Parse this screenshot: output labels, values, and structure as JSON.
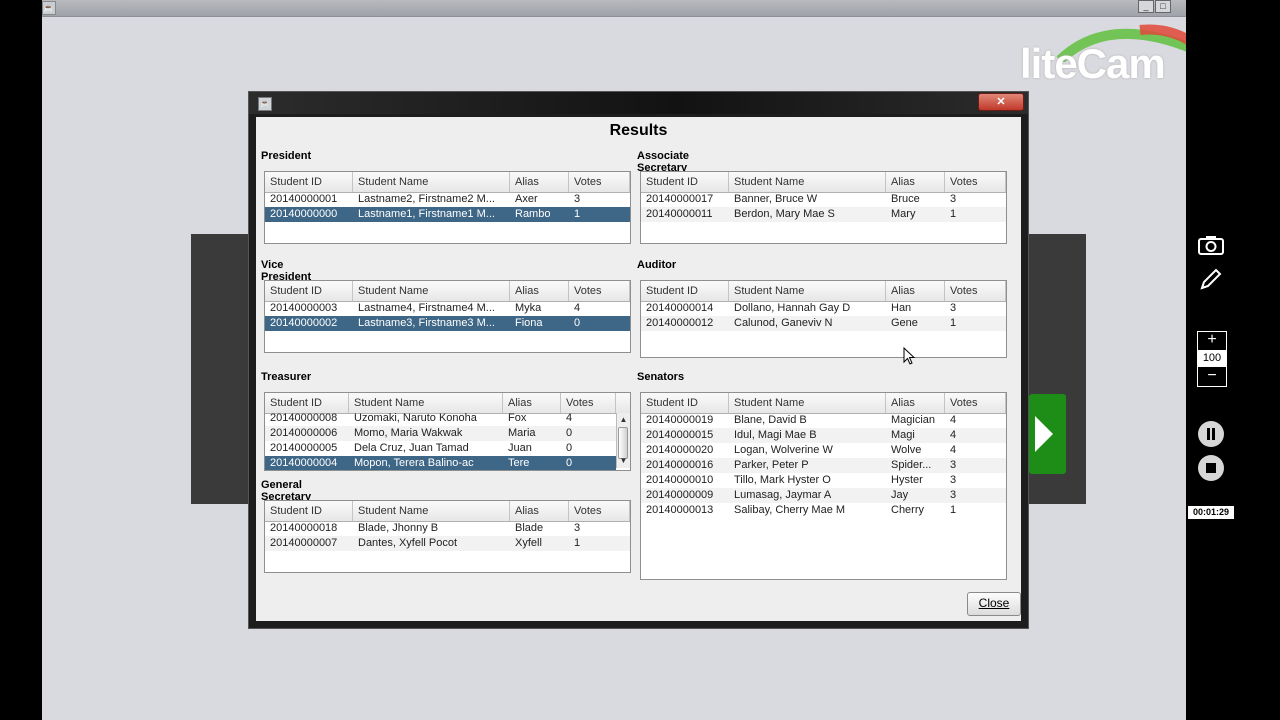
{
  "overlay": {
    "brand": "liteCam",
    "zoom_value": "100",
    "zoom_plus": "+",
    "zoom_minus": "−",
    "timer": "00:01:29"
  },
  "dialog": {
    "heading": "Results",
    "close_label": "Close",
    "columns": {
      "id": "Student ID",
      "name": "Student Name",
      "alias": "Alias",
      "votes": "Votes"
    },
    "sections": {
      "president": {
        "label": "President",
        "rows": [
          {
            "id": "20140000001",
            "name": "Lastname2, Firstname2  M...",
            "alias": "Axer",
            "votes": "3"
          },
          {
            "id": "20140000000",
            "name": "Lastname1, Firstname1  M...",
            "alias": "Rambo",
            "votes": "1"
          }
        ]
      },
      "vice_president": {
        "label": "Vice President",
        "rows": [
          {
            "id": "20140000003",
            "name": "Lastname4, Firstname4  M...",
            "alias": "Myka",
            "votes": "4"
          },
          {
            "id": "20140000002",
            "name": "Lastname3, Firstname3  M...",
            "alias": "Fiona",
            "votes": "0"
          }
        ]
      },
      "treasurer": {
        "label": "Treasurer",
        "rows": [
          {
            "id": "20140000008",
            "name": "Uzomaki, Naruto  Konoha",
            "alias": "Fox",
            "votes": "4"
          },
          {
            "id": "20140000006",
            "name": "Momo, Maria  Wakwak",
            "alias": "Maria",
            "votes": "0"
          },
          {
            "id": "20140000005",
            "name": "Dela Cruz, Juan  Tamad",
            "alias": "Juan",
            "votes": "0"
          },
          {
            "id": "20140000004",
            "name": "Mopon, Terera  Balino-ac",
            "alias": "Tere",
            "votes": "0"
          }
        ]
      },
      "general_secretary": {
        "label": "General Secretary",
        "rows": [
          {
            "id": "20140000018",
            "name": "Blade, Jhonny  B",
            "alias": "Blade",
            "votes": "3"
          },
          {
            "id": "20140000007",
            "name": "Dantes, Xyfell  Pocot",
            "alias": "Xyfell",
            "votes": "1"
          }
        ]
      },
      "associate_secretary": {
        "label": "Associate Secretary",
        "rows": [
          {
            "id": "20140000017",
            "name": "Banner, Bruce  W",
            "alias": "Bruce",
            "votes": "3"
          },
          {
            "id": "20140000011",
            "name": "Berdon, Mary Mae  S",
            "alias": "Mary",
            "votes": "1"
          }
        ]
      },
      "auditor": {
        "label": "Auditor",
        "rows": [
          {
            "id": "20140000014",
            "name": "Dollano, Hannah Gay  D",
            "alias": "Han",
            "votes": "3"
          },
          {
            "id": "20140000012",
            "name": "Calunod, Ganeviv  N",
            "alias": "Gene",
            "votes": "1"
          }
        ]
      },
      "senators": {
        "label": "Senators",
        "rows": [
          {
            "id": "20140000019",
            "name": "Blane, David  B",
            "alias": "Magician",
            "votes": "4"
          },
          {
            "id": "20140000015",
            "name": "Idul, Magi Mae  B",
            "alias": "Magi",
            "votes": "4"
          },
          {
            "id": "20140000020",
            "name": "Logan, Wolverine  W",
            "alias": "Wolve",
            "votes": "4"
          },
          {
            "id": "20140000016",
            "name": "Parker, Peter  P",
            "alias": "Spider...",
            "votes": "3"
          },
          {
            "id": "20140000010",
            "name": "Tillo, Mark Hyster  O",
            "alias": "Hyster",
            "votes": "3"
          },
          {
            "id": "20140000009",
            "name": "Lumasag, Jaymar  A",
            "alias": "Jay",
            "votes": "3"
          },
          {
            "id": "20140000013",
            "name": "Salibay, Cherry Mae  M",
            "alias": "Cherry",
            "votes": "1"
          }
        ]
      }
    }
  }
}
